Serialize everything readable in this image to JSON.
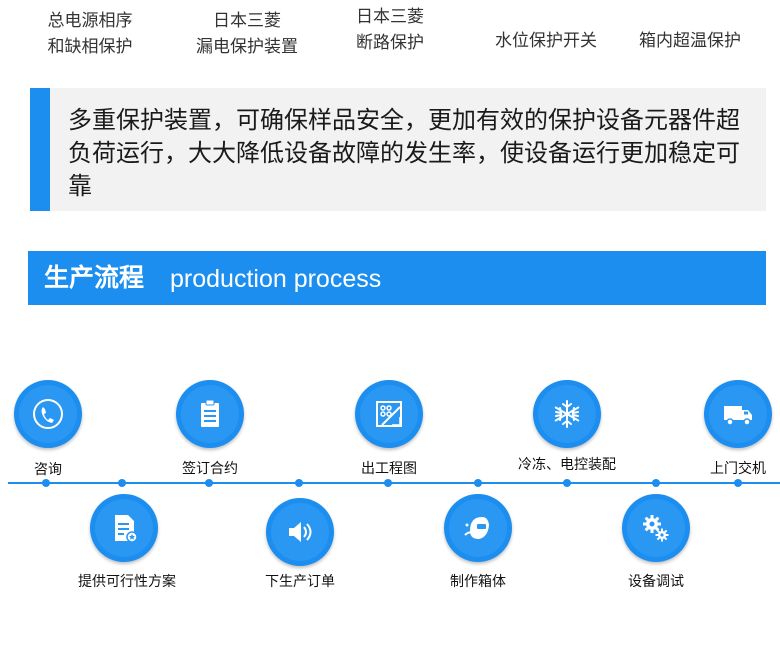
{
  "features": [
    {
      "line1": "总电源相序",
      "line2": "和缺相保护"
    },
    {
      "line1": "日本三菱",
      "line2": "漏电保护装置"
    },
    {
      "line1": "日本三菱",
      "line2": "断路保护"
    },
    {
      "line1": "水位保护开关",
      "line2": ""
    },
    {
      "line1": "箱内超温保护",
      "line2": ""
    }
  ],
  "notice": {
    "text": "多重保护装置，可确保样品安全，更加有效的保护设备元器件超负荷运行，大大降低设备故障的发生率，使设备运行更加稳定可靠"
  },
  "section": {
    "title": "生产流程",
    "subtitle": "production process"
  },
  "process_steps": [
    {
      "label": "咨询",
      "icon": "phone-icon"
    },
    {
      "label": "提供可行性方案",
      "icon": "document-icon"
    },
    {
      "label": "签订合约",
      "icon": "clipboard-icon"
    },
    {
      "label": "下生产订单",
      "icon": "speaker-icon"
    },
    {
      "label": "出工程图",
      "icon": "blueprint-icon"
    },
    {
      "label": "制作箱体",
      "icon": "welding-mask-icon"
    },
    {
      "label": "冷冻、电控装配",
      "icon": "snowflake-icon"
    },
    {
      "label": "设备调试",
      "icon": "gears-icon"
    },
    {
      "label": "上门交机",
      "icon": "truck-icon"
    }
  ],
  "colors": {
    "accent": "#1b8ef0",
    "notice_bg": "#f2f2f2"
  }
}
